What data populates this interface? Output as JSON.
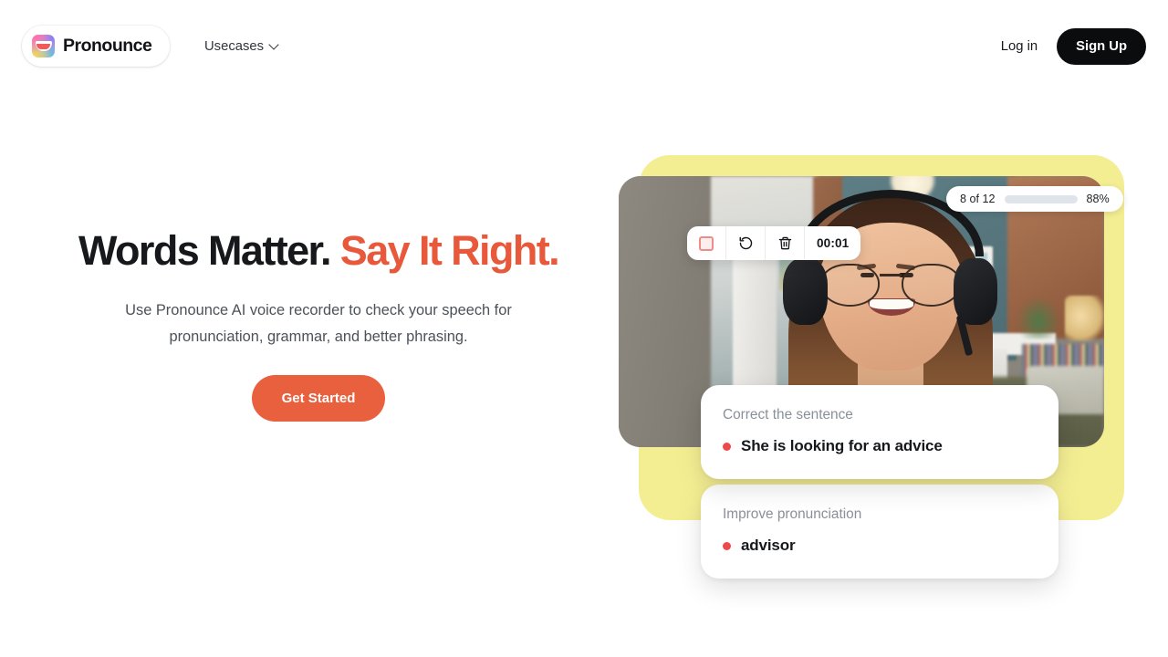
{
  "header": {
    "brand_name": "Pronounce",
    "brand_logo_icon": "mouth-gradient-logo-icon",
    "nav_items": [
      {
        "label": "Usecases",
        "caret_icon": "chevron-down-icon"
      }
    ],
    "login_label": "Log in",
    "signup_label": "Sign Up"
  },
  "hero": {
    "title_primary": "Words Matter.",
    "title_accent": "Say It Right.",
    "subtitle": "Use Pronounce AI voice recorder to check your speech for pronunciation, grammar, and better phrasing.",
    "cta_label": "Get Started"
  },
  "visual": {
    "progress": {
      "count_label": "8 of 12",
      "percent_label": "88%",
      "percent_value": 88,
      "bar_fill_ratio": 0.8,
      "bar_color": "#4f86e8",
      "track_color": "#dfe3ea"
    },
    "recorder": {
      "stop_icon": "stop-square-icon",
      "restart_icon": "restart-rotate-ccw-icon",
      "delete_icon": "trash-icon",
      "timer_label": "00:01"
    },
    "cards": [
      {
        "label": "Correct the sentence",
        "bullet_icon": "red-dot-icon",
        "text": "She is looking for an advice"
      },
      {
        "label": "Improve pronunciation",
        "bullet_icon": "red-dot-icon",
        "text": "advisor"
      }
    ],
    "photo_alt": "Smiling woman wearing headset and glasses in a living room"
  },
  "colors": {
    "accent_orange": "#e8593c",
    "cta_orange": "#e9603e",
    "frame_yellow": "#f4ee93",
    "progress_blue": "#4f86e8",
    "bullet_red": "#ef4a4a",
    "ink": "#16181c",
    "muted": "#8a9098"
  }
}
